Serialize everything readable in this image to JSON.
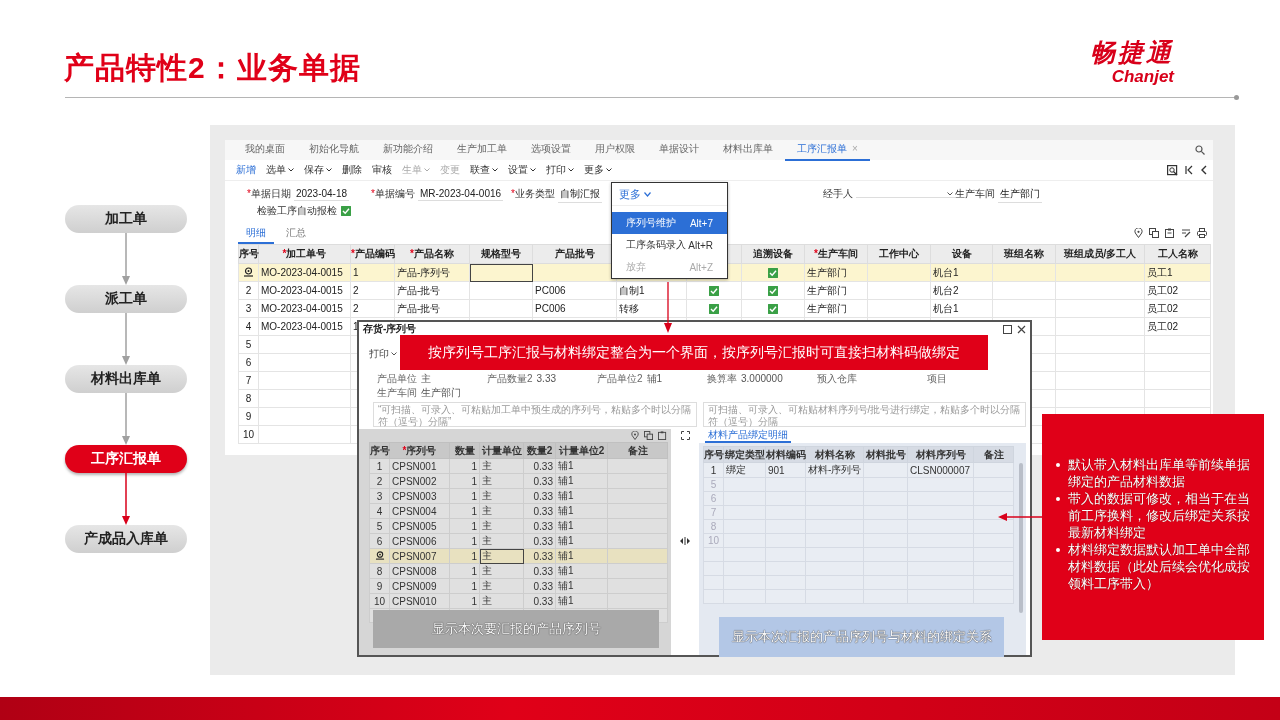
{
  "slide_title": "产品特性2：业务单据",
  "logo": {
    "name": "畅捷通",
    "latin": "Chanjet"
  },
  "flow_steps": [
    {
      "label": "加工单",
      "selected": false
    },
    {
      "label": "派工单",
      "selected": false
    },
    {
      "label": "材料出库单",
      "selected": false
    },
    {
      "label": "工序汇报单",
      "selected": true
    },
    {
      "label": "产成品入库单",
      "selected": false
    }
  ],
  "app": {
    "tabs": [
      {
        "label": "我的桌面",
        "selected": false
      },
      {
        "label": "初始化导航",
        "selected": false
      },
      {
        "label": "新功能介绍",
        "selected": false
      },
      {
        "label": "生产加工单",
        "selected": false
      },
      {
        "label": "选项设置",
        "selected": false
      },
      {
        "label": "用户权限",
        "selected": false
      },
      {
        "label": "单据设计",
        "selected": false
      },
      {
        "label": "材料出库单",
        "selected": false
      },
      {
        "label": "工序汇报单",
        "selected": true,
        "close": "×"
      }
    ],
    "toolbar": [
      {
        "label": "新增",
        "primary": true,
        "disabled": false,
        "dropdown": false
      },
      {
        "label": "选单",
        "primary": false,
        "disabled": false,
        "dropdown": true
      },
      {
        "label": "保存",
        "primary": false,
        "disabled": false,
        "dropdown": true
      },
      {
        "label": "删除",
        "primary": false,
        "disabled": false,
        "dropdown": false
      },
      {
        "label": "审核",
        "primary": false,
        "disabled": false,
        "dropdown": false
      },
      {
        "label": "生单",
        "primary": false,
        "disabled": true,
        "dropdown": true
      },
      {
        "label": "变更",
        "primary": false,
        "disabled": true,
        "dropdown": false
      },
      {
        "label": "联查",
        "primary": false,
        "disabled": false,
        "dropdown": true
      },
      {
        "label": "设置",
        "primary": false,
        "disabled": false,
        "dropdown": true
      },
      {
        "label": "打印",
        "primary": false,
        "disabled": false,
        "dropdown": true
      },
      {
        "label": "更多",
        "primary": false,
        "disabled": false,
        "dropdown": true
      }
    ],
    "form": [
      {
        "label": "单据日期",
        "required_mark": "*",
        "kind": "text",
        "value": "2023-04-18"
      },
      {
        "label": "单据编号",
        "required_mark": "*",
        "kind": "text",
        "value": "MR-2023-04-0016"
      },
      {
        "label": "业务类型",
        "required_mark": "*",
        "kind": "text",
        "value": "自制汇报"
      },
      {
        "label": "经手人",
        "kind": "select"
      },
      {
        "label": "生产车间",
        "kind": "text",
        "value": "生产部门"
      }
    ],
    "auto_inspect": {
      "label": "检验工序自动报检",
      "checked": true
    },
    "detail_tabs": [
      {
        "label": "明细",
        "selected": true
      },
      {
        "label": "汇总",
        "selected": false
      }
    ],
    "grid": {
      "columns": [
        {
          "label": "序号"
        },
        {
          "label": "加工单号",
          "required_mark": "*"
        },
        {
          "label": "产品编码",
          "required_mark": "*"
        },
        {
          "label": "产品名称",
          "required_mark": "*"
        },
        {
          "label": "规格型号"
        },
        {
          "label": "产品批号"
        },
        {},
        {},
        {
          "label": "追溯设备"
        },
        {
          "label": "生产车间",
          "required_mark": "*"
        },
        {
          "label": "工作中心"
        },
        {
          "label": "设备"
        },
        {
          "label": "班组名称"
        },
        {
          "label": "班组成员/多工人"
        },
        {
          "label": "工人名称"
        }
      ],
      "rows": [
        {
          "current": true,
          "cells": [
            null,
            "MO-2023-04-0015",
            "1",
            "产品-序列号",
            {
              "focused": true
            },
            null,
            null,
            null,
            {
              "checked": true
            },
            "生产部门",
            null,
            "机台1",
            null,
            null,
            "员工1"
          ]
        },
        {
          "current": false,
          "cells": [
            "2",
            "MO-2023-04-0015",
            "2",
            "产品-批号",
            null,
            "PC006",
            "自制1",
            {
              "checked": true
            },
            {
              "checked": true
            },
            "生产部门",
            null,
            "机台2",
            null,
            null,
            "员工02"
          ]
        },
        {
          "current": false,
          "cells": [
            "3",
            "MO-2023-04-0015",
            "2",
            "产品-批号",
            null,
            "PC006",
            "转移",
            {
              "checked": true
            },
            {
              "checked": true
            },
            "生产部门",
            null,
            "机台1",
            null,
            null,
            "员工02"
          ]
        },
        {
          "current": false,
          "cells": [
            "4",
            "MO-2023-04-0015",
            "1",
            null,
            null,
            null,
            null,
            null,
            null,
            null,
            null,
            null,
            null,
            null,
            "员工02"
          ]
        },
        {
          "current": false,
          "cells": [
            "5"
          ]
        },
        {
          "current": false,
          "cells": [
            "6"
          ]
        },
        {
          "current": false,
          "cells": [
            "7"
          ]
        },
        {
          "current": false,
          "cells": [
            "8"
          ]
        },
        {
          "current": false,
          "cells": [
            "9"
          ]
        },
        {
          "current": false,
          "cells": [
            "10"
          ]
        }
      ]
    },
    "more_menu": {
      "title": "更多",
      "items": [
        {
          "label": "序列号维护",
          "shortcut": "Alt+7",
          "selected": true,
          "disabled": false
        },
        {
          "label": "工序条码录入",
          "shortcut": "Alt+R",
          "selected": false,
          "disabled": false
        },
        {
          "label": "放弃",
          "shortcut": "Alt+Z",
          "selected": false,
          "disabled": true
        }
      ]
    }
  },
  "dialog": {
    "title": "存货-序列号",
    "print_button": "打印",
    "info": [
      {
        "label": "产品单位",
        "value": "主"
      },
      {
        "label": "产品数量2",
        "value": "3.33"
      },
      {
        "label": "产品单位2",
        "value": "辅1"
      },
      {
        "label": "换算率",
        "value": "3.000000"
      },
      {
        "label": "预入仓库"
      },
      {
        "label": "项目"
      },
      {
        "label": "生产车间",
        "value": "生产部门"
      }
    ],
    "left_input": {
      "placeholder": "“可扫描、可录入、可粘贴加工单中预生成的序列号，粘贴多个时以分隔符（逗号）分隔”"
    },
    "right_input": {
      "placeholder": "可扫描、可录入、可粘贴材料序列号/批号进行绑定，粘贴多个时以分隔符（逗号）分隔"
    },
    "left_grid": {
      "columns": [
        {
          "label": "序号"
        },
        {
          "label": "序列号",
          "required_mark": "*"
        },
        {
          "label": "数量"
        },
        {
          "label": "计量单位"
        },
        {
          "label": "数量2"
        },
        {
          "label": "计量单位2"
        },
        {
          "label": "备注"
        }
      ],
      "rows": [
        {
          "current": false,
          "cells": [
            "1",
            "CPSN001",
            "1",
            "主",
            "0.33",
            "辅1"
          ]
        },
        {
          "current": false,
          "cells": [
            "2",
            "CPSN002",
            "1",
            "主",
            "0.33",
            "辅1"
          ]
        },
        {
          "current": false,
          "cells": [
            "3",
            "CPSN003",
            "1",
            "主",
            "0.33",
            "辅1"
          ]
        },
        {
          "current": false,
          "cells": [
            "4",
            "CPSN004",
            "1",
            "主",
            "0.33",
            "辅1"
          ]
        },
        {
          "current": false,
          "cells": [
            "5",
            "CPSN005",
            "1",
            "主",
            "0.33",
            "辅1"
          ]
        },
        {
          "current": false,
          "cells": [
            "6",
            "CPSN006",
            "1",
            "主",
            "0.33",
            "辅1"
          ]
        },
        {
          "current": true,
          "cells": [
            null,
            "CPSN007",
            "1",
            {
              "text": "主",
              "focused": true
            },
            "0.33",
            "辅1"
          ]
        },
        {
          "current": false,
          "cells": [
            "8",
            "CPSN008",
            "1",
            "主",
            "0.33",
            "辅1"
          ]
        },
        {
          "current": false,
          "cells": [
            "9",
            "CPSN009",
            "1",
            "主",
            "0.33",
            "辅1"
          ]
        },
        {
          "current": false,
          "cells": [
            "10",
            "CPSN010",
            "1",
            "主",
            "0.33",
            "辅1"
          ]
        }
      ]
    },
    "right_tab": "材料产品绑定明细",
    "right_grid": {
      "columns": [
        "序号",
        "绑定类型",
        "材料编码",
        "材料名称",
        "材料批号",
        "材料序列号",
        "备注"
      ],
      "rows": [
        [
          "1",
          "绑定",
          "901",
          "材料-序列号",
          null,
          "CLSN000007"
        ],
        [
          "5"
        ],
        [
          "6"
        ],
        [
          "7"
        ],
        [
          "8"
        ],
        [
          "10"
        ]
      ]
    },
    "left_note": "显示本次要汇报的产品序列号",
    "right_note": "显示本次汇报的产品序列号与材料的绑定关系"
  },
  "banner": "按序列号工序汇报与材料绑定整合为一个界面，按序列号汇报时可直接扫材料码做绑定",
  "callout": {
    "bullets": [
      "默认带入材料出库单等前续单据绑定的产品材料数据",
      "带入的数据可修改，相当于在当前工序换料，修改后绑定关系按最新材料绑定",
      "材料绑定数据默认加工单中全部材料数据（此处后续会优化成按领料工序带入）"
    ]
  }
}
